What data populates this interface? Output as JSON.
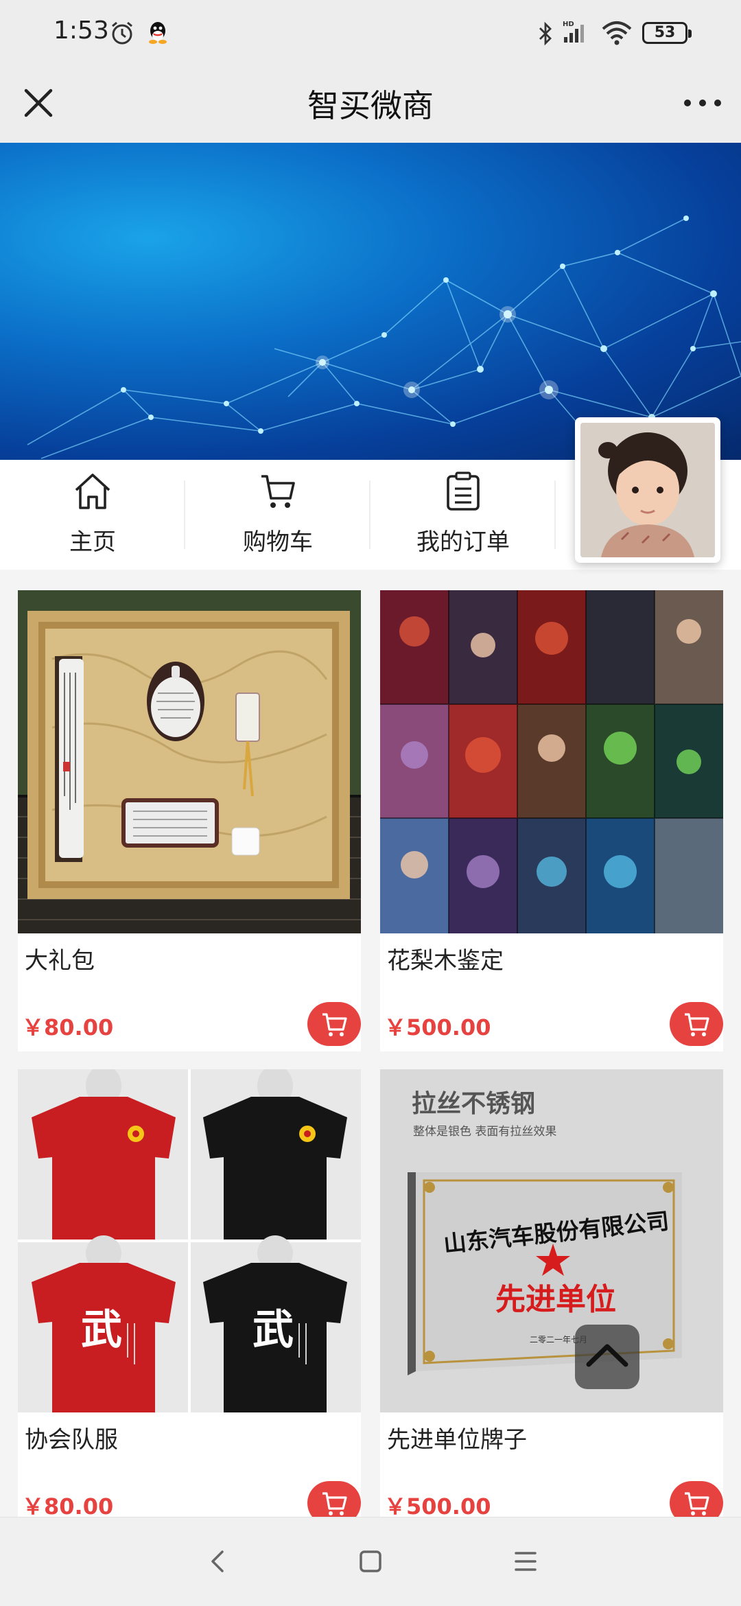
{
  "status_bar": {
    "time": "1:53",
    "battery": "53",
    "icons": [
      "alarm-icon",
      "qq-icon",
      "bluetooth-icon",
      "signal-hd-icon",
      "wifi-icon",
      "battery-icon"
    ]
  },
  "header": {
    "title": "智买微商",
    "close_icon": "close-icon",
    "more_icon": "more-icon"
  },
  "nav": {
    "items": [
      {
        "label": "主页",
        "icon": "home-icon"
      },
      {
        "label": "购物车",
        "icon": "cart-icon"
      },
      {
        "label": "我的订单",
        "icon": "order-list-icon"
      }
    ]
  },
  "products": [
    {
      "name": "大礼包",
      "price": "￥80.00"
    },
    {
      "name": "花梨木鉴定",
      "price": "￥500.00"
    },
    {
      "name": "协会队服",
      "price": "￥80.00"
    },
    {
      "name": "先进单位牌子",
      "price": "￥500.00"
    }
  ],
  "product_images": {
    "plaque_title": "拉丝不锈钢",
    "plaque_subtitle": "整体是银色 表面有拉丝效果",
    "plaque_company": "山东汽车股份有限公司",
    "plaque_award": "先进单位",
    "plaque_date": "二零二一年七月",
    "shirt_glyph": "武"
  },
  "colors": {
    "accent": "#e64340",
    "header_bg": "#ededed",
    "banner": "#0b6fc8"
  }
}
